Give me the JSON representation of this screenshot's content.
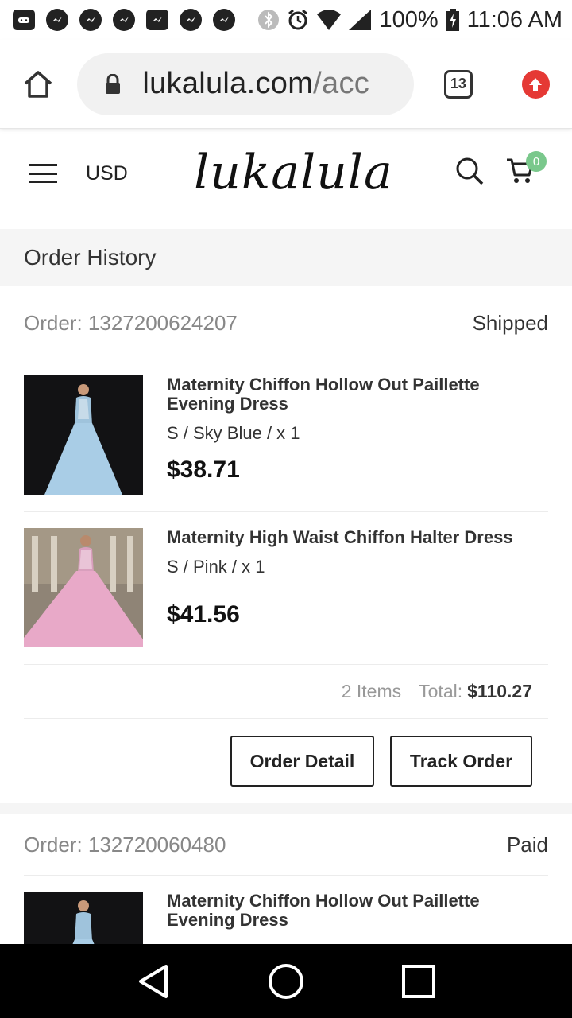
{
  "status_bar": {
    "battery": "100%",
    "time": "11:06 AM",
    "notification_icons": [
      "gamepad-icon",
      "messenger-icon",
      "messenger-icon",
      "messenger-icon",
      "chat-icon",
      "messenger-icon",
      "messenger-icon"
    ],
    "system_icons": [
      "bluetooth-icon",
      "alarm-icon",
      "wifi-icon",
      "cell-signal-icon",
      "battery-icon"
    ]
  },
  "browser": {
    "url_host": "lukalula.com",
    "url_path": "/acc",
    "tab_count": "13"
  },
  "site_header": {
    "currency": "USD",
    "logo_text": "lukalula",
    "cart_count": "0"
  },
  "page_title": "Order History",
  "orders": [
    {
      "order_label": "Order: 1327200624207",
      "status": "Shipped",
      "items": [
        {
          "name": "Maternity Chiffon Hollow Out Paillette Evening Dress",
          "variant": "S / Sky Blue / x 1",
          "price": "$38.71",
          "thumb_color": "sky-blue"
        },
        {
          "name": "Maternity High Waist Chiffon Halter Dress",
          "variant": "S / Pink / x 1",
          "price": "$41.56",
          "thumb_color": "pink"
        }
      ],
      "item_count": "2 Items",
      "total_label": "Total:",
      "total_value": "$110.27",
      "buttons": {
        "detail": "Order Detail",
        "track": "Track Order"
      }
    },
    {
      "order_label": "Order: 132720060480",
      "status": "Paid",
      "items": [
        {
          "name": "Maternity Chiffon Hollow Out Paillette Evening Dress",
          "thumb_color": "sky-blue"
        }
      ]
    }
  ],
  "colors": {
    "cart_badge": "#7ac88c",
    "update_button": "#e53935",
    "section_bg": "#f5f5f5"
  }
}
